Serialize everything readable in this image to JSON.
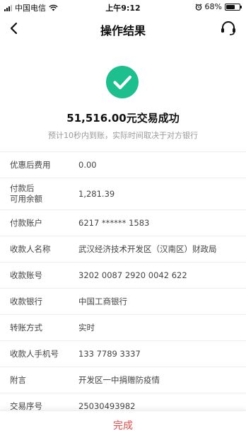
{
  "status_bar": {
    "carrier": "中国电信",
    "time": "上午9:12",
    "battery": "68%",
    "battery_level": 0.68
  },
  "nav": {
    "title": "操作结果",
    "back_icon": "chevron-left-icon",
    "service_icon": "headset-icon"
  },
  "result": {
    "status_icon": "check-circle-icon",
    "icon_color": "#1dbf8f",
    "amount_text": "51,516.00元交易成功",
    "hint": "预计10秒内到账，实际时间取决于对方银行"
  },
  "details": [
    {
      "label": "优惠后费用",
      "value": "0.00"
    },
    {
      "label": "付款后\n可用余额",
      "value": "1,281.39"
    },
    {
      "label": "付款账户",
      "value": "6217 ****** 1583"
    },
    {
      "label": "收款人名称",
      "value": "武汉经济技术开发区（汉南区）财政局"
    },
    {
      "label": "收款账号",
      "value": "3202 0087 2920 0042 622"
    },
    {
      "label": "收款银行",
      "value": "中国工商银行"
    },
    {
      "label": "转账方式",
      "value": "实时"
    },
    {
      "label": "收款人手机号",
      "value": "133 7789 3337"
    },
    {
      "label": "附言",
      "value": "开发区一中捐赠防疫情"
    },
    {
      "label": "交易序号",
      "value": "25030493982"
    }
  ],
  "footer": {
    "done_label": "完成",
    "done_color": "#e84a4a"
  }
}
